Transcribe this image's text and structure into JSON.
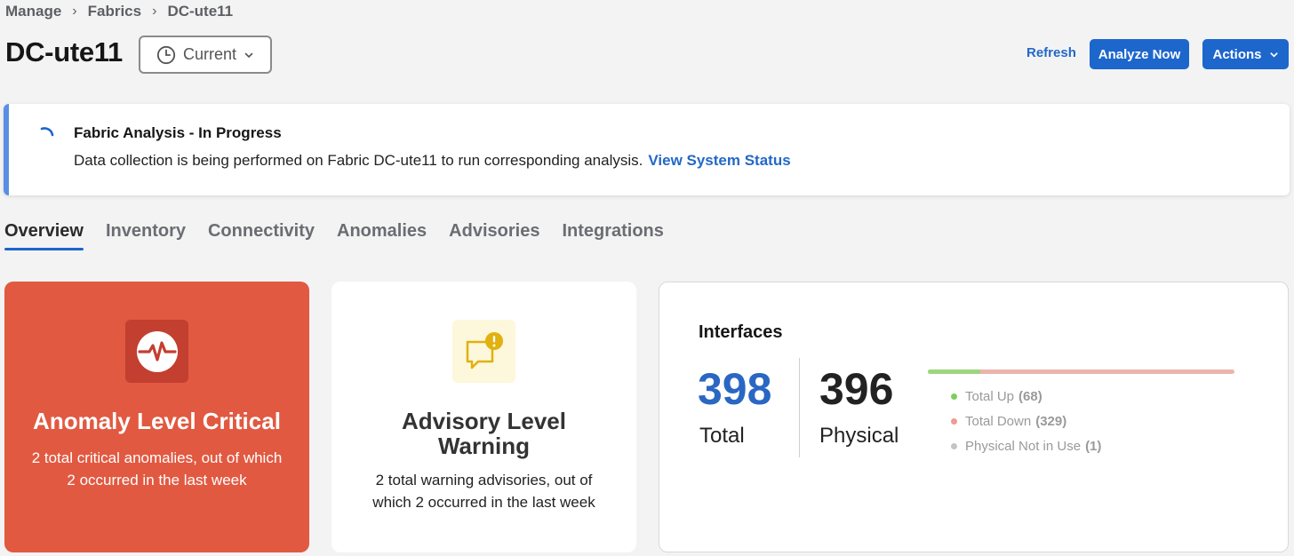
{
  "breadcrumb": {
    "items": [
      "Manage",
      "Fabrics",
      "DC-ute11"
    ]
  },
  "page_title": "DC-ute11",
  "time_select": {
    "value": "Current",
    "icon": "clock-icon"
  },
  "header_actions": {
    "refresh": "Refresh",
    "analyze_now": "Analyze Now",
    "actions": "Actions"
  },
  "banner": {
    "title": "Fabric Analysis - In Progress",
    "text": "Data collection is being performed on Fabric DC-ute11 to run corresponding analysis.",
    "link": "View System Status",
    "accent_color": "#5a8ee6"
  },
  "tabs": [
    {
      "label": "Overview",
      "active": true
    },
    {
      "label": "Inventory"
    },
    {
      "label": "Connectivity"
    },
    {
      "label": "Anomalies"
    },
    {
      "label": "Advisories"
    },
    {
      "label": "Integrations"
    }
  ],
  "anomaly_card": {
    "title": "Anomaly Level Critical",
    "description": "2 total critical anomalies, out of which 2 occurred in the last week",
    "icon": "pulse-icon",
    "color": "#e15941"
  },
  "advisory_card": {
    "title": "Advisory Level Warning",
    "description": "2 total warning advisories, out of which 2 occurred in the last week",
    "icon": "message-alert-icon",
    "color": "#f0c419"
  },
  "interfaces": {
    "title": "Interfaces",
    "total": "398",
    "total_label": "Total",
    "physical": "396",
    "physical_label": "Physical",
    "up_fraction": 0.171,
    "legend": [
      {
        "label": "Total Up",
        "count": "(68)",
        "color": "#7ccf5a"
      },
      {
        "label": "Total Down",
        "count": "(329)",
        "color": "#ef9a93"
      },
      {
        "label": "Physical Not in Use",
        "count": "(1)",
        "color": "#c4c4c4"
      }
    ]
  }
}
